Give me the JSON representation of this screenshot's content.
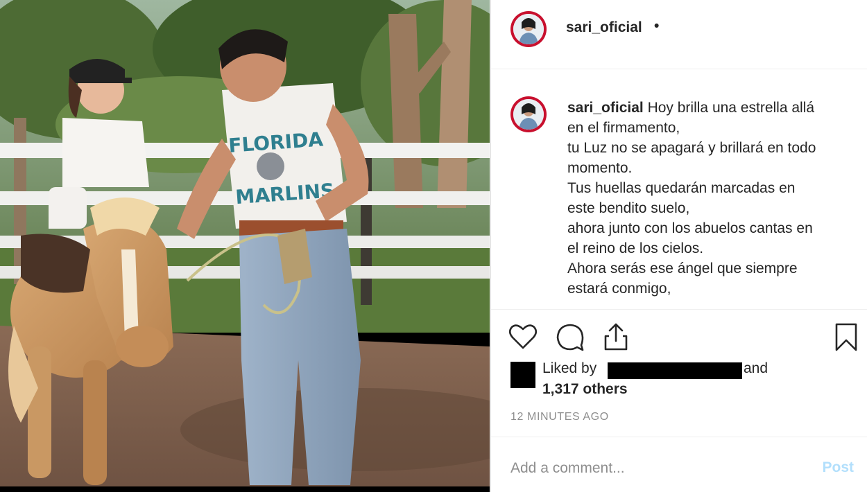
{
  "post": {
    "username": "sari_oficial",
    "header_dot": "•",
    "caption_user": "sari_oficial",
    "caption_lines": [
      "Hoy brilla una estrella allá",
      "en el firmamento,",
      "tu Luz no se apagará y brillará en todo",
      "momento.",
      "Tus huellas quedarán marcadas en",
      "este bendito suelo,",
      "ahora junto con los abuelos cantas en",
      "el reino de los cielos.",
      "Ahora serás ese ángel que siempre",
      "estará conmigo,"
    ],
    "likes_prefix": "Liked by",
    "likes_and": "and",
    "likes_count": "1,317 others",
    "timestamp": "12 MINUTES AGO"
  },
  "photo": {
    "shirt_text_top": "FLORIDA",
    "shirt_text_bottom": "MARLINS"
  },
  "actions": {
    "like_icon": "heart-icon",
    "comment_icon": "comment-icon",
    "share_icon": "share-icon",
    "save_icon": "bookmark-icon"
  },
  "comment": {
    "placeholder": "Add a comment...",
    "post_label": "Post"
  },
  "colors": {
    "text": "#262626",
    "muted": "#8e8e8e",
    "post_disabled": "#b2dffc",
    "avatar_ring": "#c8102e"
  }
}
